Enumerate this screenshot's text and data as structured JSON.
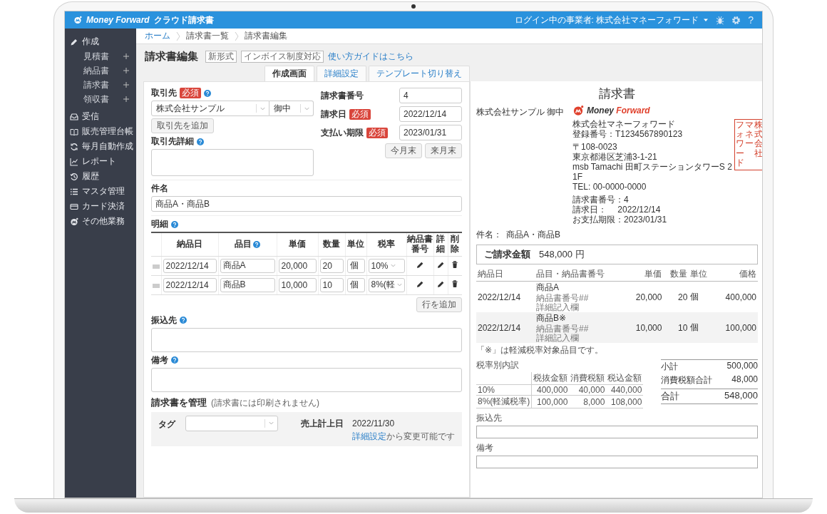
{
  "header": {
    "logo_words": [
      "Money",
      "Forward"
    ],
    "product": "クラウド請求書",
    "login": "ログイン中の事業者: 株式会社マネーフォワード",
    "help_glyph": "?"
  },
  "sidebar": {
    "items": [
      {
        "label": "作成",
        "children": [
          {
            "label": "見積書"
          },
          {
            "label": "納品書"
          },
          {
            "label": "請求書"
          },
          {
            "label": "領収書"
          }
        ]
      },
      {
        "label": "受信"
      },
      {
        "label": "販売管理台帳"
      },
      {
        "label": "毎月自動作成"
      },
      {
        "label": "レポート"
      },
      {
        "label": "履歴"
      },
      {
        "label": "マスタ管理"
      },
      {
        "label": "カード決済"
      },
      {
        "label": "その他業務"
      }
    ]
  },
  "breadcrumb": [
    {
      "label": "ホーム",
      "link": true
    },
    {
      "label": "請求書一覧",
      "link": false
    },
    {
      "label": "請求書編集",
      "link": false
    }
  ],
  "page_title": "請求書編集",
  "title_tags": [
    "新形式",
    "インボイス制度対応"
  ],
  "guide_link": "使い方ガイドはこちら",
  "tabs": [
    {
      "label": "作成画面",
      "selected": true
    },
    {
      "label": "詳細設定",
      "selected": false
    },
    {
      "label": "テンプレート切り替え",
      "selected": false
    }
  ],
  "form": {
    "client": {
      "label": "取引先",
      "badge": "必須",
      "help": true,
      "value": "株式会社サンプル",
      "honorific": "御中",
      "add_button": "取引先を追加"
    },
    "client_detail": {
      "label": "取引先詳細",
      "help": true
    },
    "invoice_fields": [
      {
        "label": "請求書番号",
        "value": "4"
      },
      {
        "label": "請求日",
        "badge": "必須",
        "value": "2022/12/14"
      },
      {
        "label": "支払い期限",
        "badge": "必須",
        "value": "2023/01/31"
      }
    ],
    "date_buttons": [
      "今月末",
      "来月末"
    ],
    "subject": {
      "label": "件名",
      "value": "商品A・商品B"
    },
    "details": {
      "label": "明細",
      "help": true,
      "columns": [
        {
          "label": "納品日",
          "help": false
        },
        {
          "label": "品目",
          "help": true
        },
        {
          "label": "単価",
          "help": false
        },
        {
          "label": "数量",
          "help": false
        },
        {
          "label": "単位",
          "help": false
        },
        {
          "label": "税率",
          "help": false
        },
        {
          "label": "納品書番号",
          "help": false
        },
        {
          "label": "詳細",
          "help": false
        },
        {
          "label": "削除",
          "help": false
        }
      ],
      "rows": [
        {
          "date": "2022/12/14",
          "item": "商品A",
          "price": "20,000",
          "qty": "20",
          "unit": "個",
          "tax": "10%"
        },
        {
          "date": "2022/12/14",
          "item": "商品B",
          "price": "10,000",
          "qty": "10",
          "unit": "個",
          "tax": "8%(軽"
        }
      ],
      "add_row": "行を追加"
    },
    "bank": {
      "label": "振込先",
      "help": true
    },
    "memo": {
      "label": "備考",
      "help": true
    },
    "manage": {
      "title": "請求書を管理",
      "note": "(請求書には印刷されません)",
      "tag_label": "タグ",
      "sales_date_label": "売上計上日",
      "sales_date": "2022/11/30",
      "settings_link": "詳細設定",
      "settings_suffix": "から変更可能です"
    }
  },
  "preview": {
    "title": "請求書",
    "recipient": "株式会社サンプル 御中",
    "logo_words": [
      "Money",
      "Forward"
    ],
    "company_lines": [
      "株式会社マネーフォワード",
      "登録番号：T1234567890123"
    ],
    "address_lines": [
      "〒108-0023",
      "東京都港区芝浦3-1-21",
      "msb Tamachi 田町ステーションタワーS 2",
      "1F",
      "TEL: 00-0000-0000"
    ],
    "meta_lines": [
      "請求書番号：4",
      "請求日：　 2022/12/14",
      "お支払期限：2023/01/31"
    ],
    "stamp": [
      "フォワード",
      "マネー",
      "株式会社"
    ],
    "subject_label": "件名：",
    "subject": "商品A・商品B",
    "amount_label": "ご請求金額",
    "amount": "548,000 円",
    "item_columns": [
      "納品日",
      "品目・納品書番号",
      "単価",
      "数量",
      "単位",
      "価格"
    ],
    "items": [
      {
        "date": "2022/12/14",
        "name": "商品A",
        "sub": [
          "納品書番号##",
          "詳細記入欄"
        ],
        "price": "20,000",
        "qty": "20",
        "unit": "個",
        "total": "400,000",
        "shaded": false
      },
      {
        "date": "2022/12/14",
        "name": "商品B※",
        "sub": [
          "納品書番号##",
          "詳細記入欄"
        ],
        "price": "10,000",
        "qty": "10",
        "unit": "個",
        "total": "100,000",
        "shaded": true
      }
    ],
    "note": "「※」は軽減税率対象品目です。",
    "tax_table": {
      "title": "税率別内訳",
      "columns": [
        "税抜金額",
        "消費税額",
        "税込金額"
      ],
      "rows": [
        {
          "rate": "10%",
          "values": [
            "400,000",
            "40,000",
            "440,000"
          ]
        },
        {
          "rate": "8%(軽減税率)",
          "values": [
            "100,000",
            "8,000",
            "108,000"
          ]
        }
      ]
    },
    "totals": [
      {
        "label": "小計",
        "value": "500,000",
        "kind": "line"
      },
      {
        "label": "消費税額合計",
        "value": "48,000",
        "kind": "line"
      },
      {
        "label": "合計",
        "value": "548,000",
        "kind": "grand"
      }
    ],
    "bank_label": "振込先",
    "memo_label": "備考"
  }
}
